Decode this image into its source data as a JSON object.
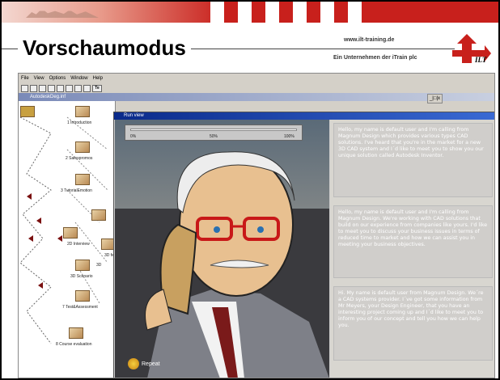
{
  "slide": {
    "title": "Vorschaumodus",
    "url": "www.ilt-training.de",
    "company": "Ein Unternehmen der iTrain plc",
    "logo_text": "ILT"
  },
  "app": {
    "menu": [
      "File",
      "View",
      "Options",
      "Window",
      "Help"
    ],
    "toolbar_text": "Te",
    "doc_title": "AutodeskDeg.inf",
    "win_controls": "_|□|x",
    "flow_labels": [
      "1 Introduction",
      "2 Salespromos",
      "3 TutorialEmotion",
      "2D Interview",
      "3D fe",
      "3D Scenario",
      "3D",
      "7 Test&Assessment",
      "8 Course evaluation"
    ],
    "run_title": "Run view",
    "progress_ticks": [
      "0%",
      "50%",
      "100%"
    ],
    "replay_label": "Repeat",
    "messages": [
      "Hello, my name is default user and I'm calling from Magnum Design which provides various types CAD solutions. I've heard that you're in the market for a new 3D CAD system and I´d like to meet you to show you our unique solution called Autodesk Inventor.",
      "Hello, my name is default user and I'm calling from Magnum Design. We're working with CAD solutions that build on our experience from companies like yours. I'd like to meet you to discuss your business issues in terms of reduced time to market and how we can assist you in meeting your business objectives.",
      "Hi. My name is default user from Magnum Design. We´re a CAD systems provider. I´ve got some information from Mr Meyers, your Design Engineer, that you have an interesting project coming up and I´d like to meet you to inform you of our concept and tell you how we can help you."
    ]
  },
  "colors": {
    "brand_red": "#c8201c",
    "title_bar_blue": "#0a2a8a"
  }
}
